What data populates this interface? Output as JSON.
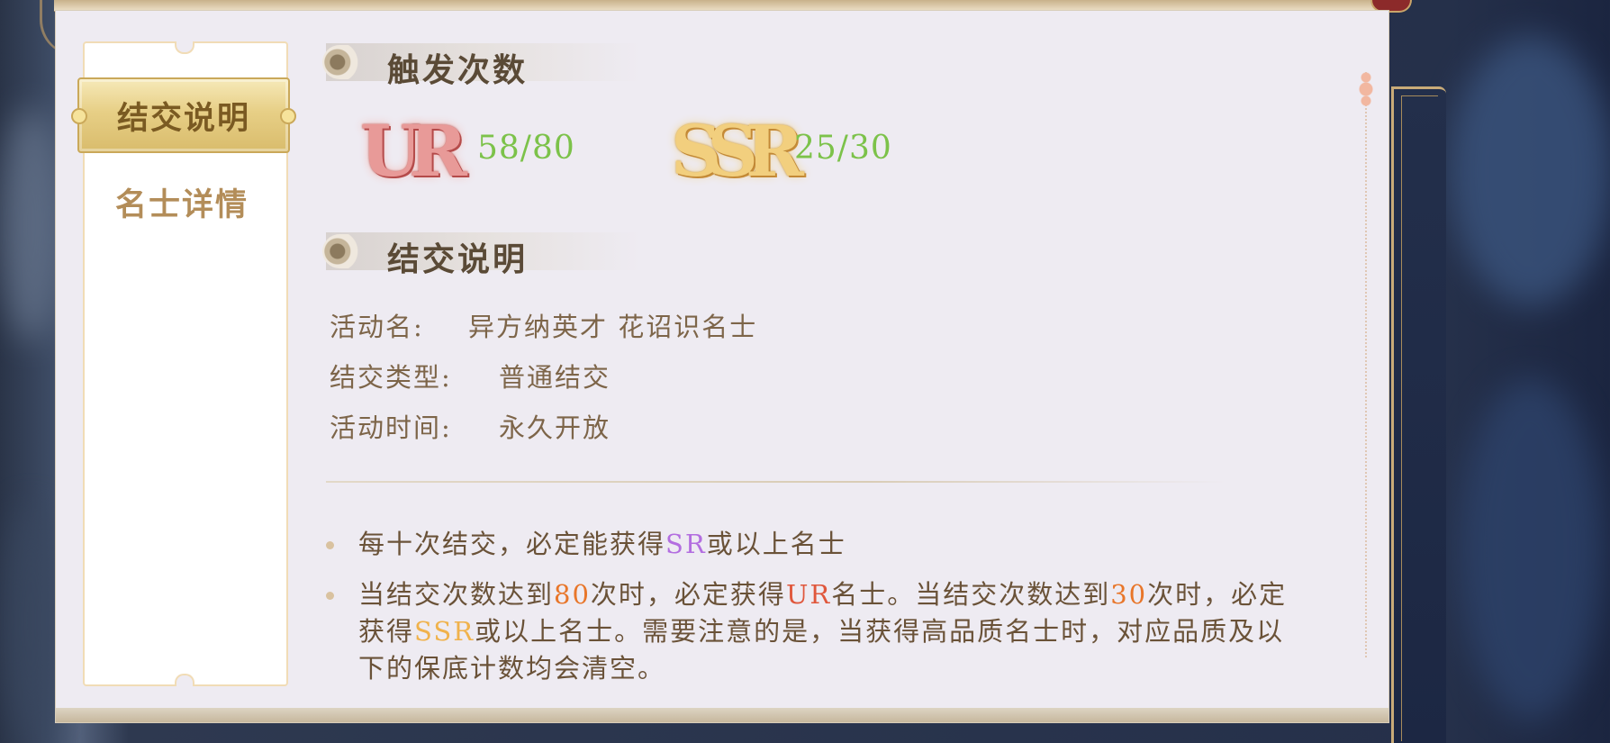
{
  "sidebar": {
    "tabs": [
      {
        "label": "结交说明",
        "active": true
      },
      {
        "label": "名士详情",
        "active": false
      }
    ]
  },
  "trigger_section": {
    "title": "触发次数",
    "rarities": [
      {
        "badge": "UR",
        "count": "58/80"
      },
      {
        "badge": "SSR",
        "count": "25/30"
      }
    ]
  },
  "desc_section": {
    "title": "结交说明",
    "rows": [
      {
        "label": "活动名:",
        "value": "异方纳英才 花诏识名士"
      },
      {
        "label": "结交类型:",
        "value": "普通结交"
      },
      {
        "label": "活动时间:",
        "value": "永久开放"
      }
    ]
  },
  "rules": {
    "r1": {
      "a": "每十次结交，必定能获得",
      "sr": "SR",
      "b": "或以上名士"
    },
    "r2": {
      "a": "当结交次数达到",
      "n80": "80",
      "b": "次时，必定获得",
      "ur": "UR",
      "c": "名士。当结交次数达到",
      "n30": "30",
      "d": "次时，必定获得",
      "ssr": "SSR",
      "e": "或以上名士。需要注意的是，当获得高品质名士时，对应品质及以下的保底计数均会清空。"
    }
  },
  "colors": {
    "count_green": "#7cc24a",
    "sr_purple": "#b36ee0",
    "highlight_orange": "#e8762a",
    "ur_red": "#e0573c",
    "ssr_gold": "#f0b24c"
  }
}
